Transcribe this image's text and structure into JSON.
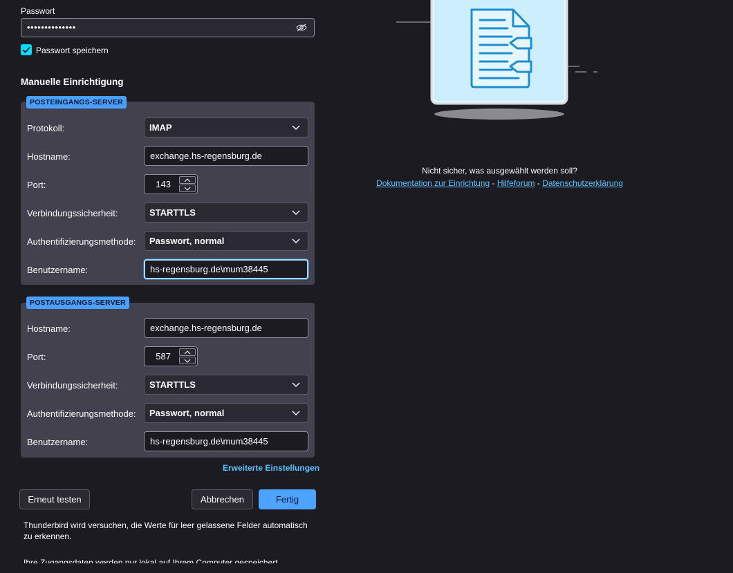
{
  "password": {
    "label": "Passwort",
    "value_masked": "••••••••••••••",
    "save_label": "Passwort speichern",
    "save_checked": true
  },
  "manual": {
    "title": "Manuelle Einrichtigung"
  },
  "incoming": {
    "badge": "POSTEINGANGS-SERVER",
    "protocol_label": "Protokoll:",
    "protocol_value": "IMAP",
    "hostname_label": "Hostname:",
    "hostname_value": "exchange.hs-regensburg.de",
    "port_label": "Port:",
    "port_value": "143",
    "security_label": "Verbindungssicherheit:",
    "security_value": "STARTTLS",
    "auth_label": "Authentifizierungsmethode:",
    "auth_value": "Passwort, normal",
    "user_label": "Benutzername:",
    "user_value": "hs-regensburg.de\\mum38445"
  },
  "outgoing": {
    "badge": "POSTAUSGANGS-SERVER",
    "hostname_label": "Hostname:",
    "hostname_value": "exchange.hs-regensburg.de",
    "port_label": "Port:",
    "port_value": "587",
    "security_label": "Verbindungssicherheit:",
    "security_value": "STARTTLS",
    "auth_label": "Authentifizierungsmethode:",
    "auth_value": "Passwort, normal",
    "user_label": "Benutzername:",
    "user_value": "hs-regensburg.de\\mum38445"
  },
  "advanced_label": "Erweiterte Einstellungen",
  "buttons": {
    "retest": "Erneut testen",
    "cancel": "Abbrechen",
    "done": "Fertig"
  },
  "notes": {
    "autodetect": "Thunderbird wird versuchen, die Werte für leer gelassene Felder automatisch zu erkennen.",
    "local_only": "Ihre Zugangsdaten werden nur lokal auf Ihrem Computer gespeichert."
  },
  "help": {
    "question": "Nicht sicher, was ausgewählt werden soll?",
    "doc_link": "Dokumentation zur Einrichtung",
    "forum_link": "Hilfeforum",
    "privacy_link": "Datenschutzerklärung",
    "separator": " - "
  },
  "colors": {
    "background": "#1c1b22",
    "panel": "#42414d",
    "accent": "#4da3ff",
    "link": "#5cc3ff"
  }
}
